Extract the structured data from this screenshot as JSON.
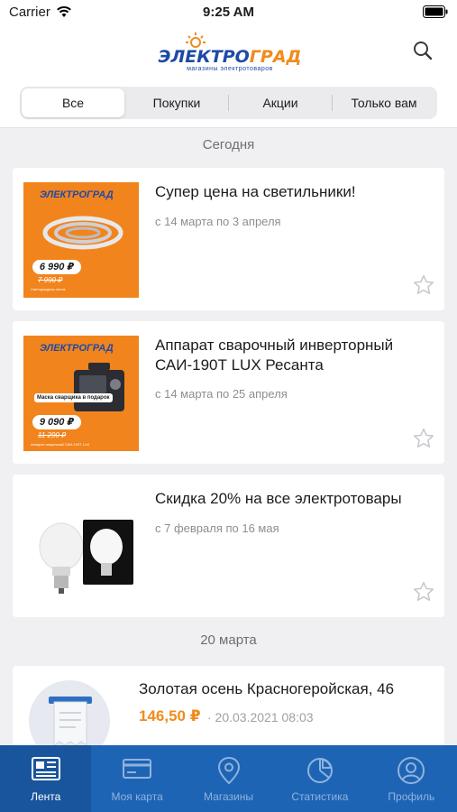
{
  "status_bar": {
    "carrier": "Carrier",
    "time": "9:25 AM"
  },
  "header": {
    "logo_text_part1": "ЭЛЕКТРО",
    "logo_text_part2": "ГРАД",
    "logo_subtitle": "магазины электротоваров",
    "search_icon": "search-icon"
  },
  "tabs_filter": [
    {
      "label": "Все",
      "active": true
    },
    {
      "label": "Покупки",
      "active": false
    },
    {
      "label": "Акции",
      "active": false
    },
    {
      "label": "Только вам",
      "active": false
    }
  ],
  "feed": {
    "section_today": "Сегодня",
    "section_march": "20 марта",
    "promos": [
      {
        "title": "Супер цена на светильники!",
        "dates": "с 14 марта по 3 апреля",
        "image": {
          "logo": "ЭЛЕКТРОГРАД",
          "price": "6 990 ₽",
          "old_price": "7 990 ₽",
          "fine_print": "Светодиодная лента"
        }
      },
      {
        "title": "Аппарат сварочный инверторный САИ-190Т LUX Ресанта",
        "dates": "с 14 марта по 25 апреля",
        "image": {
          "logo": "ЭЛЕКТРОГРАД",
          "gift": "Маска сварщика в подарок",
          "price": "9 090 ₽",
          "old_price": "11 290 ₽",
          "fine_print": "Аппарат сварочный САИ-190Т LUX"
        }
      },
      {
        "title": "Скидка 20% на все электротовары",
        "dates": "с 7 февраля по 16 мая"
      }
    ],
    "purchase": {
      "store": "Золотая осень Красногеройская, 46",
      "amount": "146,50 ₽",
      "date": "· 20.03.2021 08:03"
    }
  },
  "tab_bar": [
    {
      "label": "Лента",
      "icon": "feed-icon",
      "active": true
    },
    {
      "label": "Моя карта",
      "icon": "card-icon",
      "active": false
    },
    {
      "label": "Магазины",
      "icon": "map-pin-icon",
      "active": false
    },
    {
      "label": "Статистика",
      "icon": "pie-chart-icon",
      "active": false
    },
    {
      "label": "Профиль",
      "icon": "profile-icon",
      "active": false
    }
  ],
  "colors": {
    "brand_blue": "#1e64b4",
    "brand_orange": "#f2841d",
    "price_orange": "#f08b1c"
  }
}
